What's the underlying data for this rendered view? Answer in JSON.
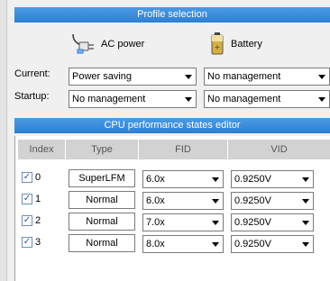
{
  "profile": {
    "header": "Profile selection",
    "ac_label": "AC power",
    "battery_label": "Battery",
    "current_label": "Current:",
    "startup_label": "Startup:",
    "current_ac": "Power saving",
    "current_battery": "No management",
    "startup_ac": "No management",
    "startup_battery": "No management"
  },
  "editor": {
    "header": "CPU performance states editor",
    "columns": [
      "Index",
      "Type",
      "FID",
      "VID"
    ],
    "rows": [
      {
        "index": "0",
        "checked": true,
        "type": "SuperLFM",
        "fid": "6.0x",
        "vid": "0.9250V"
      },
      {
        "index": "1",
        "checked": true,
        "type": "Normal",
        "fid": "6.0x",
        "vid": "0.9250V"
      },
      {
        "index": "2",
        "checked": true,
        "type": "Normal",
        "fid": "7.0x",
        "vid": "0.9250V"
      },
      {
        "index": "3",
        "checked": true,
        "type": "Normal",
        "fid": "8.0x",
        "vid": "0.9250V"
      }
    ]
  },
  "icons": {
    "ac": "power-plug-icon",
    "battery": "battery-icon",
    "check": "checkmark-icon",
    "dropdown": "chevron-down-icon"
  }
}
